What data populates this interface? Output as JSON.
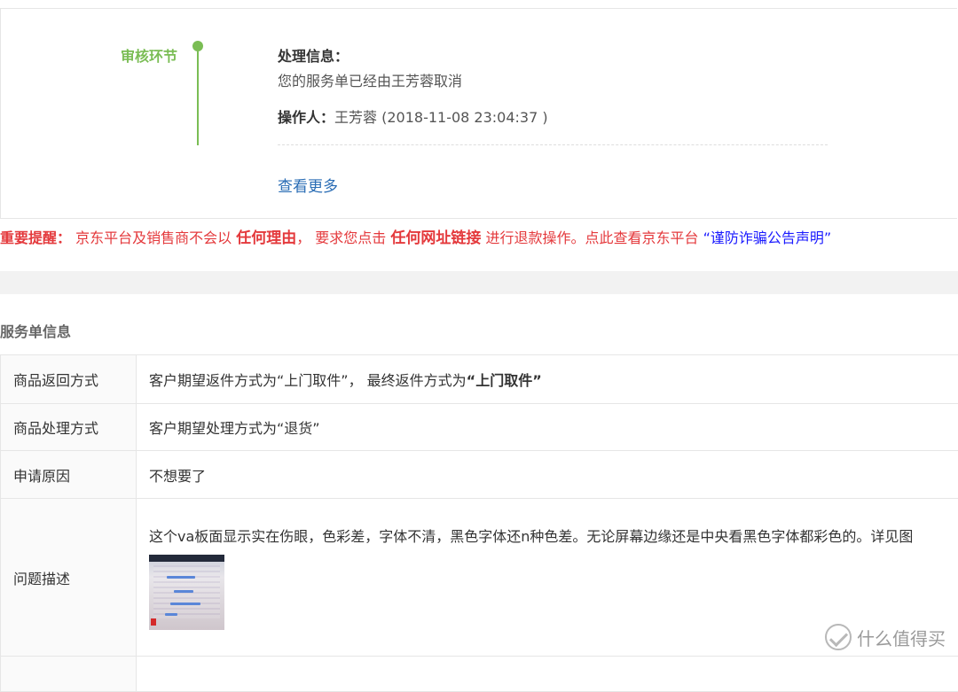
{
  "progress": {
    "stage_label": "审核环节",
    "info_title": "处理信息：",
    "message": "您的服务单已经由王芳蓉取消",
    "operator_label": "操作人：",
    "operator_value": "王芳蓉 (2018-11-08 23:04:37 )",
    "see_more": "查看更多",
    "accent_color": "#7abd54",
    "link_color": "#2a6db5"
  },
  "notice": {
    "label": "重要提醒：",
    "part1": " 京东平台及销售商不会以 ",
    "strong1": "任何理由",
    "part2": "， 要求您点击 ",
    "strong2": "任何网址链接",
    "part3": " 进行退款操作。点此查看京东平台 ",
    "link": "“谨防诈骗公告声明”",
    "color": "#e4393c",
    "link_color": "#1a1aff"
  },
  "service_info": {
    "title": "服务单信息",
    "rows": [
      {
        "key": "商品返回方式",
        "value_prefix": "客户期望返件方式为“上门取件”， 最终返件方式为",
        "value_bold": "“上门取件”"
      },
      {
        "key": "商品处理方式",
        "value": "客户期望处理方式为“退货”"
      },
      {
        "key": "申请原因",
        "value": "不想要了"
      },
      {
        "key": "问题描述",
        "value": "这个va板面显示实在伤眼，色彩差，字体不清，黑色字体还n种色差。无论屏幕边缘还是中央看黑色字体都彩色的。详见图"
      }
    ]
  },
  "watermark": {
    "text": "什么值得买",
    "icon": "smzdm-logo-icon"
  }
}
